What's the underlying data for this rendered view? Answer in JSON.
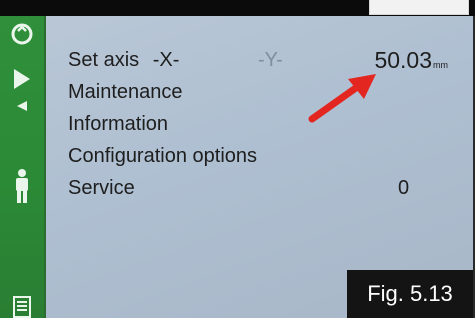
{
  "menu": {
    "items": [
      {
        "label": "Set axis",
        "x_axis": "-X-",
        "y_axis": "-Y-",
        "value": "50.03",
        "unit": "mm"
      },
      {
        "label": "Maintenance"
      },
      {
        "label": "Information"
      },
      {
        "label": "Configuration options"
      },
      {
        "label": "Service",
        "value": "0"
      }
    ]
  },
  "side_icons": [
    "power-icon",
    "play-right-icon",
    "play-left-icon",
    "person-icon",
    "document-list-icon"
  ],
  "figure_caption": "Fig. 5.13",
  "colors": {
    "screen_bg": "#b4c3d3",
    "side_rail": "#2e8b37",
    "arrow": "#e3261f",
    "caption_bg": "#141414"
  }
}
